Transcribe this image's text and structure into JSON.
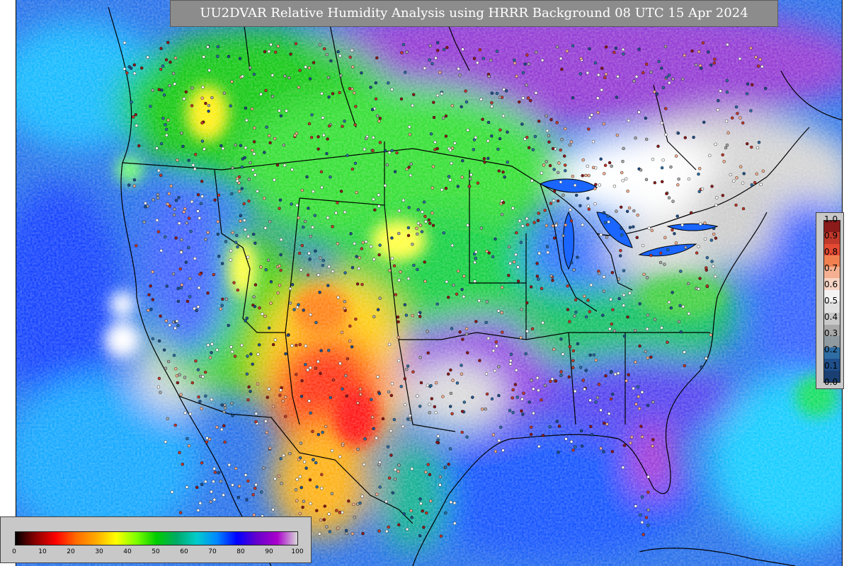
{
  "title": "UU2DVAR Relative Humidity Analysis using HRRR Background 08 UTC 15 Apr 2024",
  "ratio_scale": {
    "labels": [
      "1.0",
      "0.9",
      "0.8",
      "0.7",
      "0.6",
      "0.5",
      "0.4",
      "0.3",
      "0.2",
      "0.1",
      "0.0"
    ],
    "colors": [
      "#8b1a1a",
      "#c0392b",
      "#e34a33",
      "#f08050",
      "#f4b090",
      "#f7d4c4",
      "#f4f4f4",
      "#e0e0e0",
      "#c8c8c8",
      "#a8a8a8",
      "#8f9aa0",
      "#2e6da4",
      "#1f4e8a",
      "#1a3f72"
    ]
  },
  "rh_colorbar": {
    "ticks": [
      "0",
      "10",
      "20",
      "30",
      "40",
      "50",
      "60",
      "70",
      "80",
      "90",
      "100"
    ],
    "colors": [
      "#000000",
      "#8b0000",
      "#ff0000",
      "#ff6a00",
      "#ffaa00",
      "#ffff00",
      "#7dff00",
      "#00cc00",
      "#00aa66",
      "#00cccc",
      "#0088ff",
      "#0000ff",
      "#6600cc",
      "#aa00cc",
      "#d8d8d8"
    ]
  }
}
